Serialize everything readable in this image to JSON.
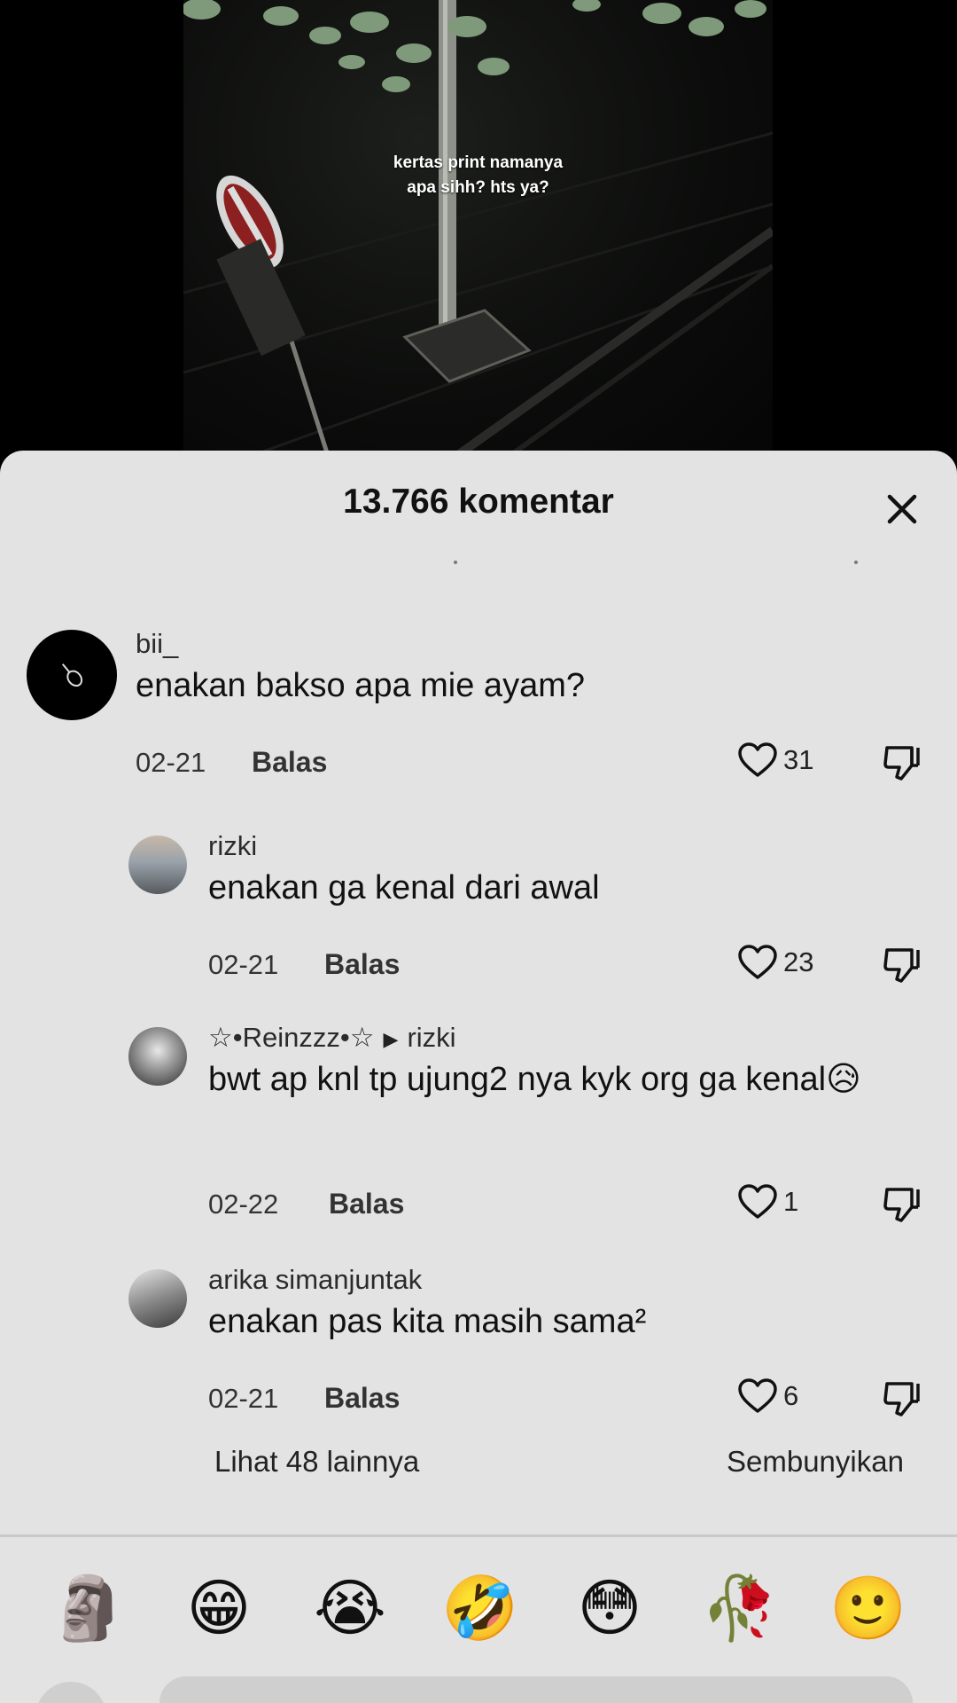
{
  "video": {
    "caption_line1": "kertas print namanya",
    "caption_line2": "apa sihh? hts ya?"
  },
  "sheet": {
    "title": "13.766 komentar",
    "close_icon": "close-icon"
  },
  "comments": [
    {
      "username": "bii_",
      "text": "enakan bakso apa mie ayam?",
      "date": "02-21",
      "reply_label": "Balas",
      "likes": "31"
    },
    {
      "username": "rizki",
      "text": "enakan ga kenal dari awal",
      "date": "02-21",
      "reply_label": "Balas",
      "likes": "23"
    },
    {
      "username": "☆•Reinzzz•☆",
      "reply_to": "rizki",
      "text": "bwt ap knl tp ujung2 nya kyk org ga kenal",
      "emoji": "😥",
      "date": "02-22",
      "reply_label": "Balas",
      "likes": "1"
    },
    {
      "username": "arika simanjuntak",
      "text": "enakan pas kita masih sama²",
      "date": "02-21",
      "reply_label": "Balas",
      "likes": "6"
    }
  ],
  "replies_footer": {
    "more_label": "Lihat 48 lainnya",
    "hide_label": "Sembunyikan"
  },
  "emoji_bar": [
    "🗿",
    "😁",
    "😭",
    "🤣",
    "😳",
    "🥀",
    "🙂"
  ],
  "colors": {
    "sheet_bg": "#e3e3e3",
    "text": "#111111"
  }
}
